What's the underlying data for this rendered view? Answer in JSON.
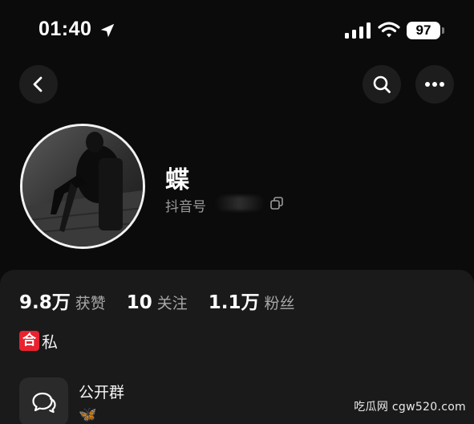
{
  "status_bar": {
    "time": "01:40",
    "battery": "97"
  },
  "nav": {
    "back_icon": "chevron-left-icon",
    "search_icon": "search-icon",
    "more_icon": "more-horizontal-icon"
  },
  "profile": {
    "nickname": "蝶",
    "douyin_id_label": "抖音号",
    "douyin_id_value": "",
    "copy_icon": "copy-icon"
  },
  "stats": [
    {
      "value": "9.8万",
      "label": "获赞"
    },
    {
      "value": "10",
      "label": "关注"
    },
    {
      "value": "1.1万",
      "label": "粉丝"
    }
  ],
  "bio": {
    "badge": "合",
    "text": "私"
  },
  "group": {
    "title": "公开群",
    "subtitle": "🦋",
    "icon": "chat-bubbles-icon"
  },
  "watermark": "吃瓜网 cgw520.com",
  "colors": {
    "background": "#0b0b0b",
    "panel": "#1a1a1a",
    "badge_red": "#e8232f",
    "muted_text": "#a8a8a8"
  }
}
